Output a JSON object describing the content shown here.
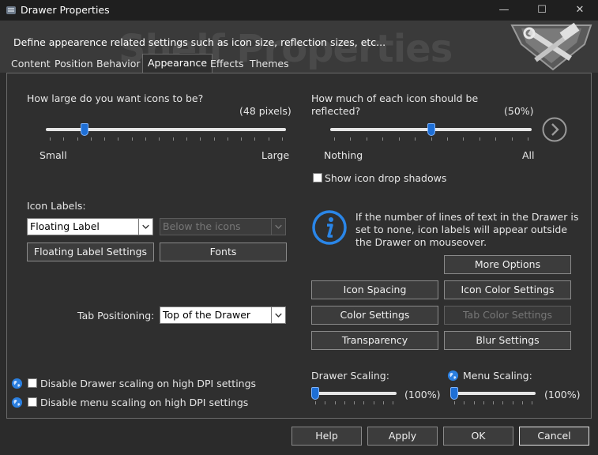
{
  "window": {
    "title": "Drawer Properties",
    "minimize_icon": "minimize-icon",
    "maximize_icon": "maximize-icon",
    "close_icon": "close-icon"
  },
  "header": {
    "description": "Define appearence related settings such as icon size, reflection sizes, etc...",
    "watermark": "Shelf Properties"
  },
  "tabs": [
    {
      "label": "Content",
      "active": false
    },
    {
      "label": "Position",
      "active": false
    },
    {
      "label": "Behavior",
      "active": false
    },
    {
      "label": "Appearance",
      "active": true
    },
    {
      "label": "Effects",
      "active": false
    },
    {
      "label": "Themes",
      "active": false
    }
  ],
  "icon_size": {
    "question": "How large do you want icons to be?",
    "value_text": "(48 pixels)",
    "min_label": "Small",
    "max_label": "Large",
    "level": 0.15
  },
  "reflection": {
    "question_line1": "How much of each icon should be",
    "question_line2": "reflected?",
    "value_text": "(50%)",
    "min_label": "Nothing",
    "max_label": "All",
    "level": 0.5
  },
  "shadows": {
    "label": "Show icon drop shadows",
    "checked": false
  },
  "icon_labels": {
    "heading": "Icon Labels:",
    "style_value": "Floating Label",
    "position_value": "Below the icons",
    "settings_button": "Floating Label Settings",
    "fonts_button": "Fonts"
  },
  "info": {
    "text": "If the number of lines of text in the Drawer is set to none, icon labels will appear outside the Drawer on mouseover.",
    "icon": "info-icon"
  },
  "buttons": {
    "more_options": "More Options",
    "icon_spacing": "Icon Spacing",
    "icon_color_settings": "Icon Color Settings",
    "color_settings": "Color Settings",
    "tab_color_settings": "Tab Color Settings",
    "transparency": "Transparency",
    "blur_settings": "Blur Settings"
  },
  "tab_positioning": {
    "label": "Tab Positioning:",
    "value": "Top of the Drawer"
  },
  "drawer_scaling": {
    "label": "Drawer Scaling:",
    "value_text": "(100%)",
    "level": 0.0
  },
  "menu_scaling": {
    "label": "Menu Scaling:",
    "value_text": "(100%)",
    "level": 0.0
  },
  "dpi": {
    "drawer_label": "Disable Drawer scaling on high DPI settings",
    "menu_label": "Disable menu scaling on high DPI settings",
    "drawer_checked": false,
    "menu_checked": false
  },
  "footer": {
    "help": "Help",
    "apply": "Apply",
    "ok": "OK",
    "cancel": "Cancel"
  },
  "colors": {
    "accent": "#1e6fd6",
    "background": "#2b2b2b",
    "panel": "#2f2f2f"
  }
}
